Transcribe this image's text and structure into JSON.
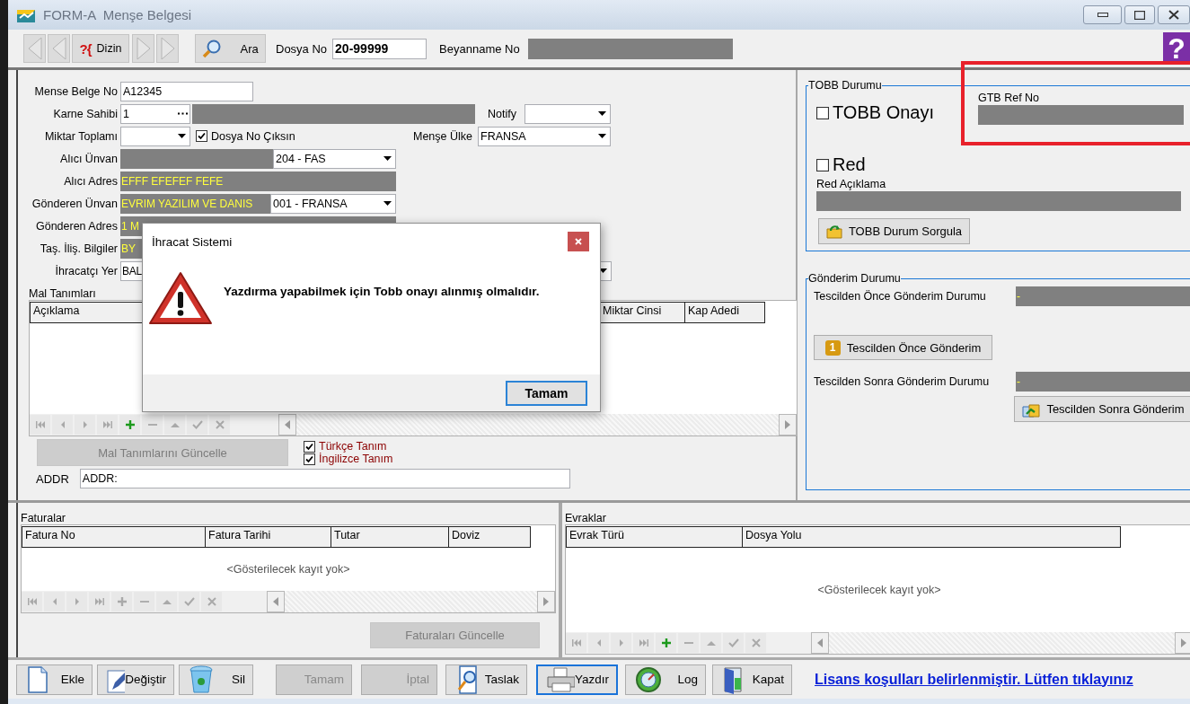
{
  "window": {
    "title": "FORM-A  Menşe Belgesi"
  },
  "toolbar": {
    "nav": [
      {
        "kind": "back",
        "disabled": true
      },
      {
        "kind": "back",
        "disabled": true
      },
      {
        "kind": "forward",
        "disabled": true
      },
      {
        "kind": "forward",
        "disabled": true
      }
    ],
    "dizin": {
      "glyph": "?{",
      "label": "Dizin"
    },
    "ara": "Ara",
    "dosya_no": {
      "label": "Dosya No",
      "value": "20-99999"
    },
    "beyanname_no": {
      "label": "Beyanname No"
    },
    "help_glyph": "?"
  },
  "form": {
    "mense_belge_no": {
      "label": "Mense Belge No",
      "value": "A12345"
    },
    "karne_sahibi": {
      "label": "Karne Sahibi",
      "value": "1"
    },
    "notify": {
      "label": "Notify"
    },
    "miktar_toplami": {
      "label": "Miktar Toplamı"
    },
    "dosya_no_ciksin": {
      "label": "Dosya No Çıksın",
      "checked": true
    },
    "mense_ulke": {
      "label": "Menşe Ülke",
      "value": "FRANSA"
    },
    "alici_unvan": {
      "label": "Alıcı Ünvan",
      "country": "204 - FAS"
    },
    "alici_adres": {
      "label": "Alıcı Adres",
      "value": "EFFF EFEFEF FEFE"
    },
    "gonderen_unvan": {
      "label": "Gönderen Ünvan",
      "value": "EVRIM YAZILIM VE DANIS",
      "country": "001 - FRANSA"
    },
    "gonderen_adres": {
      "label": "Gönderen Adres",
      "value": "1 M"
    },
    "tas_ilis_bilgiler": {
      "label": "Taş. İliş. Bilgiler",
      "value": "BY"
    },
    "ihracatci_yer": {
      "label": "İhracatçı Yer",
      "value": "BAL"
    }
  },
  "goods": {
    "title": "Mal Tanımları",
    "columns": [
      "Açıklama",
      "Miktar Cinsi",
      "Kap Adedi"
    ],
    "add_enabled": true,
    "update_button": {
      "label": "Mal Tanımlarını Güncelle",
      "disabled": true
    },
    "options": [
      {
        "label": "Türkçe Tanım",
        "checked": true
      },
      {
        "label": "İngilizce Tanım",
        "checked": true
      }
    ],
    "addr": {
      "label": "ADDR",
      "value": "ADDR:"
    }
  },
  "tobb": {
    "title": "TOBB Durumu",
    "approval": {
      "label": "TOBB Onayı",
      "checked": false
    },
    "gtb_ref": {
      "label": "GTB Ref No"
    },
    "reject": {
      "label": "Red",
      "checked": false
    },
    "reject_note": {
      "label": "Red Açıklama"
    },
    "query_button": "TOBB Durum Sorgula"
  },
  "sending": {
    "title": "Gönderim Durumu",
    "before": {
      "label": "Tescilden Önce Gönderim Durumu",
      "value": "-"
    },
    "before_button": {
      "badge": "1",
      "label": "Tescilden Önce Gönderim"
    },
    "after": {
      "label": "Tescilden Sonra Gönderim Durumu",
      "value": "-"
    },
    "after_button": "Tescilden Sonra Gönderim"
  },
  "invoices": {
    "title": "Faturalar",
    "columns": [
      "Fatura No",
      "Fatura Tarihi",
      "Tutar",
      "Doviz"
    ],
    "empty": "<Gösterilecek kayıt yok>",
    "add_enabled": false,
    "update_button": {
      "label": "Faturaları Güncelle",
      "disabled": true
    }
  },
  "documents": {
    "title": "Evraklar",
    "columns": [
      "Evrak Türü",
      "Dosya Yolu"
    ],
    "empty": "<Gösterilecek kayıt yok>",
    "add_enabled": true
  },
  "actions": [
    {
      "kind": "add",
      "label": "Ekle",
      "disabled": false,
      "focused": false
    },
    {
      "kind": "edit",
      "label": "Değiştir",
      "disabled": false,
      "focused": false
    },
    {
      "kind": "delete",
      "label": "Sil",
      "disabled": false,
      "focused": false
    },
    {
      "kind": "confirm",
      "label": "Tamam",
      "disabled": true,
      "focused": false
    },
    {
      "kind": "cancel",
      "label": "İptal",
      "disabled": true,
      "focused": false
    },
    {
      "kind": "draft",
      "label": "Taslak",
      "disabled": false,
      "focused": false
    },
    {
      "kind": "print",
      "label": "Yazdır",
      "disabled": false,
      "focused": true
    },
    {
      "kind": "log",
      "label": "Log",
      "disabled": false,
      "focused": false
    },
    {
      "kind": "close",
      "label": "Kapat",
      "disabled": false,
      "focused": false
    }
  ],
  "license_link": "Lisans koşulları belirlenmiştir. Lütfen tıklayınız",
  "dialog": {
    "title": "İhracat Sistemi",
    "message": "Yazdırma yapabilmek için Tobb onayı alınmış olmalıdır.",
    "button": "Tamam"
  },
  "highlight_frame": true
}
